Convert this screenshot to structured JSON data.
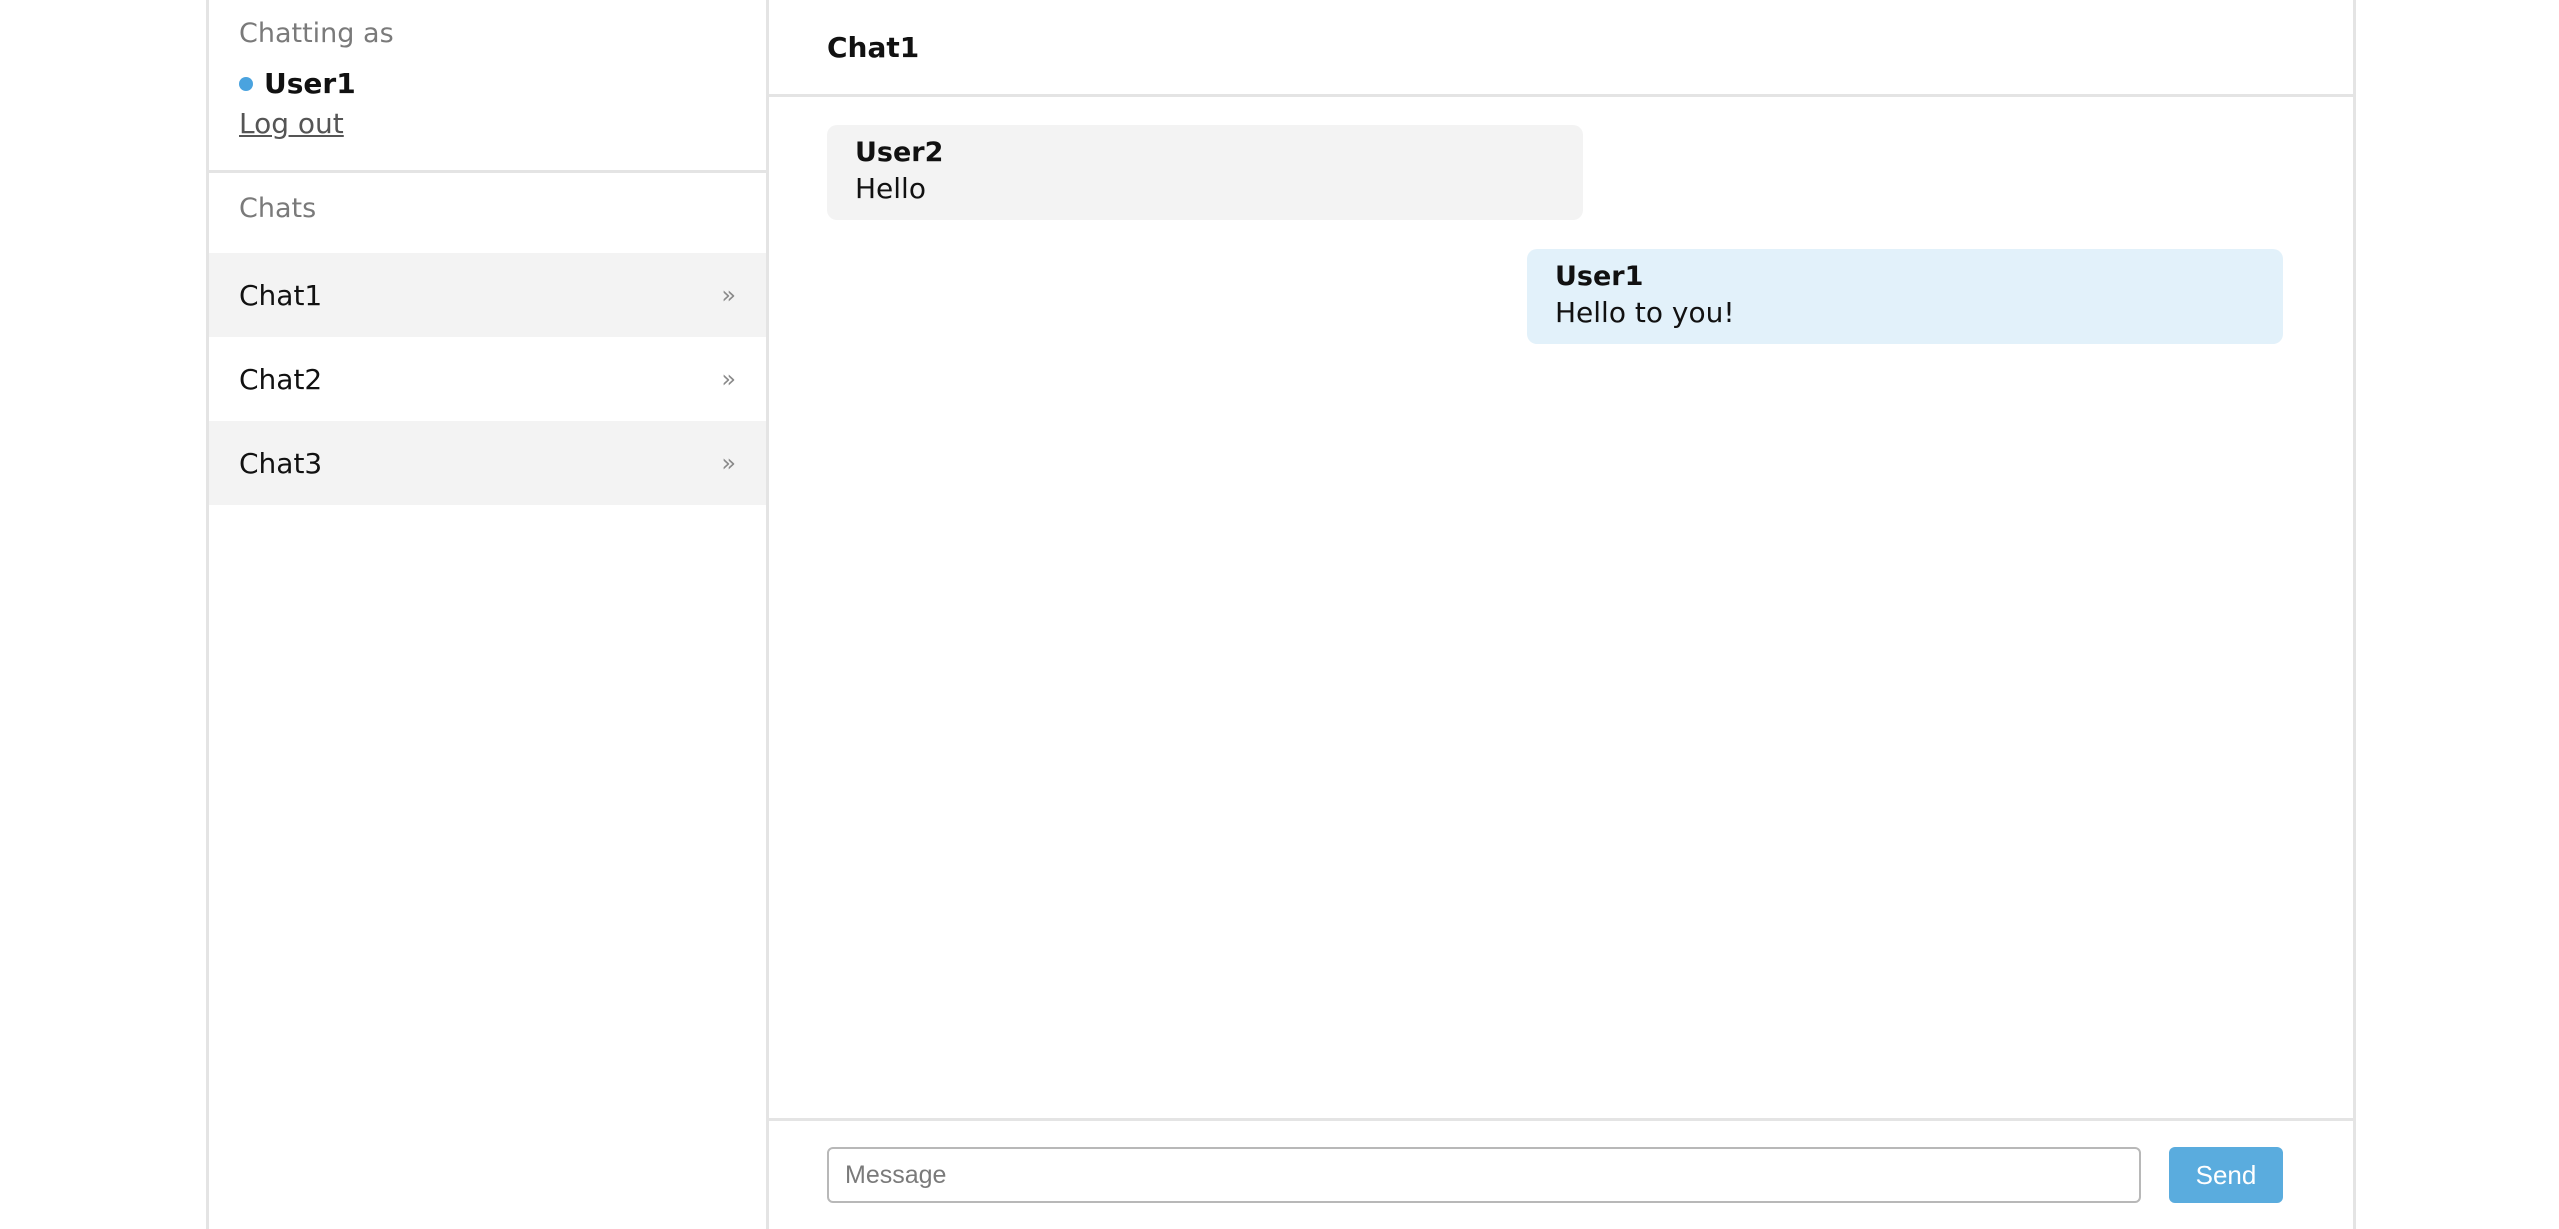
{
  "sidebar": {
    "chatting_as_label": "Chatting as",
    "current_user": "User1",
    "status_color": "#4aa3df",
    "logout_label": "Log out",
    "chats_heading": "Chats",
    "chats": [
      {
        "label": "Chat1",
        "chevron": "»",
        "shaded": true,
        "active": true
      },
      {
        "label": "Chat2",
        "chevron": "»",
        "shaded": false,
        "active": false
      },
      {
        "label": "Chat3",
        "chevron": "»",
        "shaded": true,
        "active": false
      }
    ]
  },
  "main": {
    "title": "Chat1",
    "messages": [
      {
        "author": "User2",
        "text": "Hello",
        "direction": "incoming"
      },
      {
        "author": "User1",
        "text": "Hello to you!",
        "direction": "outgoing"
      }
    ],
    "composer": {
      "placeholder": "Message",
      "value": "",
      "send_label": "Send",
      "send_color": "#5aacde"
    }
  }
}
